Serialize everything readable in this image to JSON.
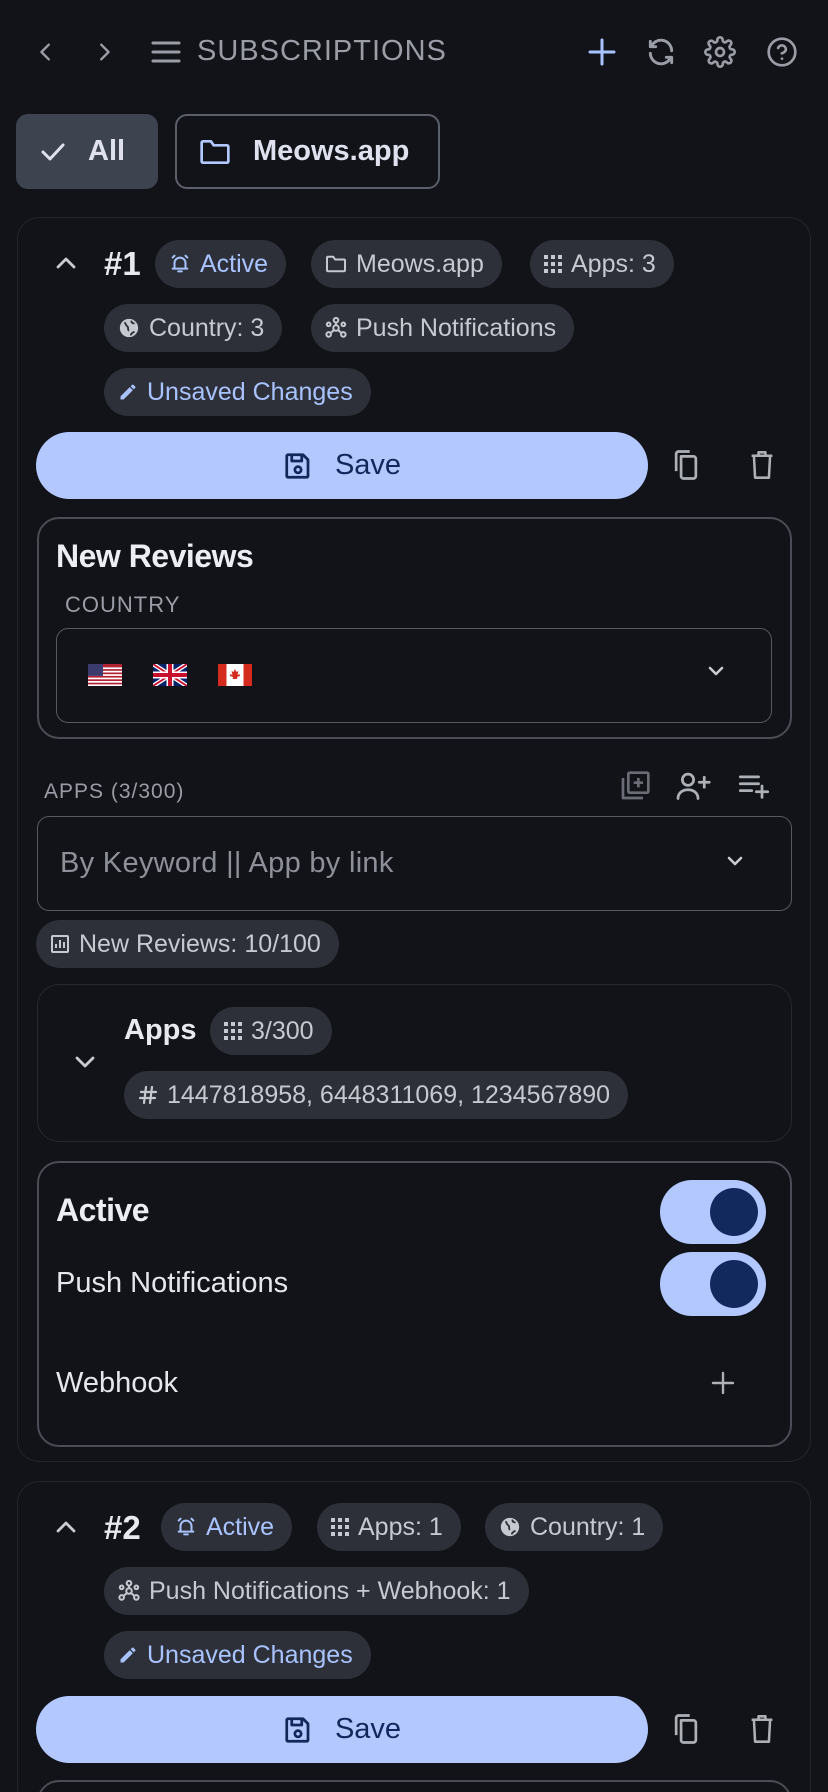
{
  "topbar": {
    "title": "SUBSCRIPTIONS",
    "icons": [
      "chevron-left-icon",
      "chevron-right-icon",
      "menu-icon",
      "plus-icon",
      "refresh-icon",
      "gear-icon",
      "help-icon"
    ]
  },
  "folders": [
    {
      "label": "All",
      "selected": true
    },
    {
      "label": "Meows.app",
      "selected": false
    }
  ],
  "sub1": {
    "number": "#1",
    "chips": {
      "status": "Active",
      "folder": "Meows.app",
      "apps": "Apps: 3",
      "country": "Country: 3",
      "channel": "Push Notifications",
      "unsaved": "Unsaved Changes"
    },
    "save_label": "Save",
    "event_title": "New Reviews",
    "country_label": "COUNTRY",
    "countries": [
      "US",
      "GB",
      "CA"
    ],
    "apps_label": "APPS (3/300)",
    "search_placeholder": "By Keyword || App by link",
    "limit_chip": "New Reviews: 10/100",
    "apps_group": {
      "title": "Apps",
      "count": "3/300",
      "ids": "1447818958, 6448311069, 1234567890"
    },
    "settings": {
      "active_label": "Active",
      "active_on": true,
      "push_label": "Push Notifications",
      "push_on": true,
      "webhook_label": "Webhook"
    }
  },
  "sub2": {
    "number": "#2",
    "chips": {
      "status": "Active",
      "apps": "Apps: 1",
      "country": "Country: 1",
      "channel": "Push Notifications + Webhook: 1",
      "unsaved": "Unsaved Changes"
    },
    "save_label": "Save"
  },
  "colors": {
    "background": "#111318",
    "accent": "#b3c8ff",
    "accent_dark": "#12285a",
    "chip": "#2d3038"
  }
}
